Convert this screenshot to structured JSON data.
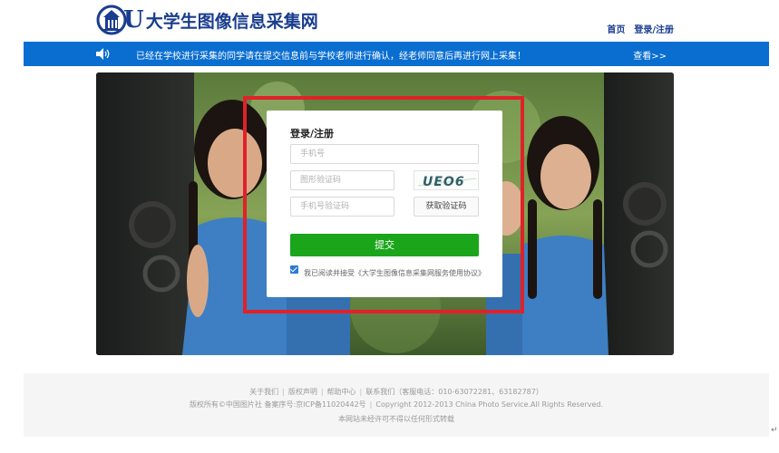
{
  "header": {
    "site_name": "大学生图像信息采集网",
    "logo_letter": "U",
    "nav": {
      "home": "首页",
      "login": "登录/注册"
    }
  },
  "notice": {
    "message": "已经在学校进行采集的同学请在提交信息前与学校老师进行确认，经老师同意后再进行网上采集！",
    "more": "查看>>"
  },
  "login": {
    "title": "登录/注册",
    "phone_placeholder": "手机号",
    "captcha_placeholder": "图形验证码",
    "captcha_text": "UEO6",
    "sms_placeholder": "手机号验证码",
    "sms_button": "获取验证码",
    "submit": "提交",
    "agree_text": "我已阅读并接受《大学生图像信息采集网服务使用协议》",
    "agree_checked": true
  },
  "footer": {
    "links": [
      "关于我们",
      "版权声明",
      "帮助中心",
      "联系我们（客服电话：010-63072281、63182787）"
    ],
    "copyright_left": "版权所有©中国图片社 备案序号:京ICP备11020442号",
    "copyright_right": "Copyright 2012-2013 China Photo Service.All Rights Reserved.",
    "notice": "本网站未经许可不得以任何形式转载"
  },
  "colors": {
    "brand_blue": "#1a3d8f",
    "bar_blue": "#0a6ed1",
    "submit_green": "#1aa51a",
    "highlight_red": "#e0212a"
  },
  "icons": {
    "speaker": "speaker-icon",
    "logo": "building-logo-icon",
    "check": "checkbox-checked-icon"
  },
  "return_mark": "↵"
}
